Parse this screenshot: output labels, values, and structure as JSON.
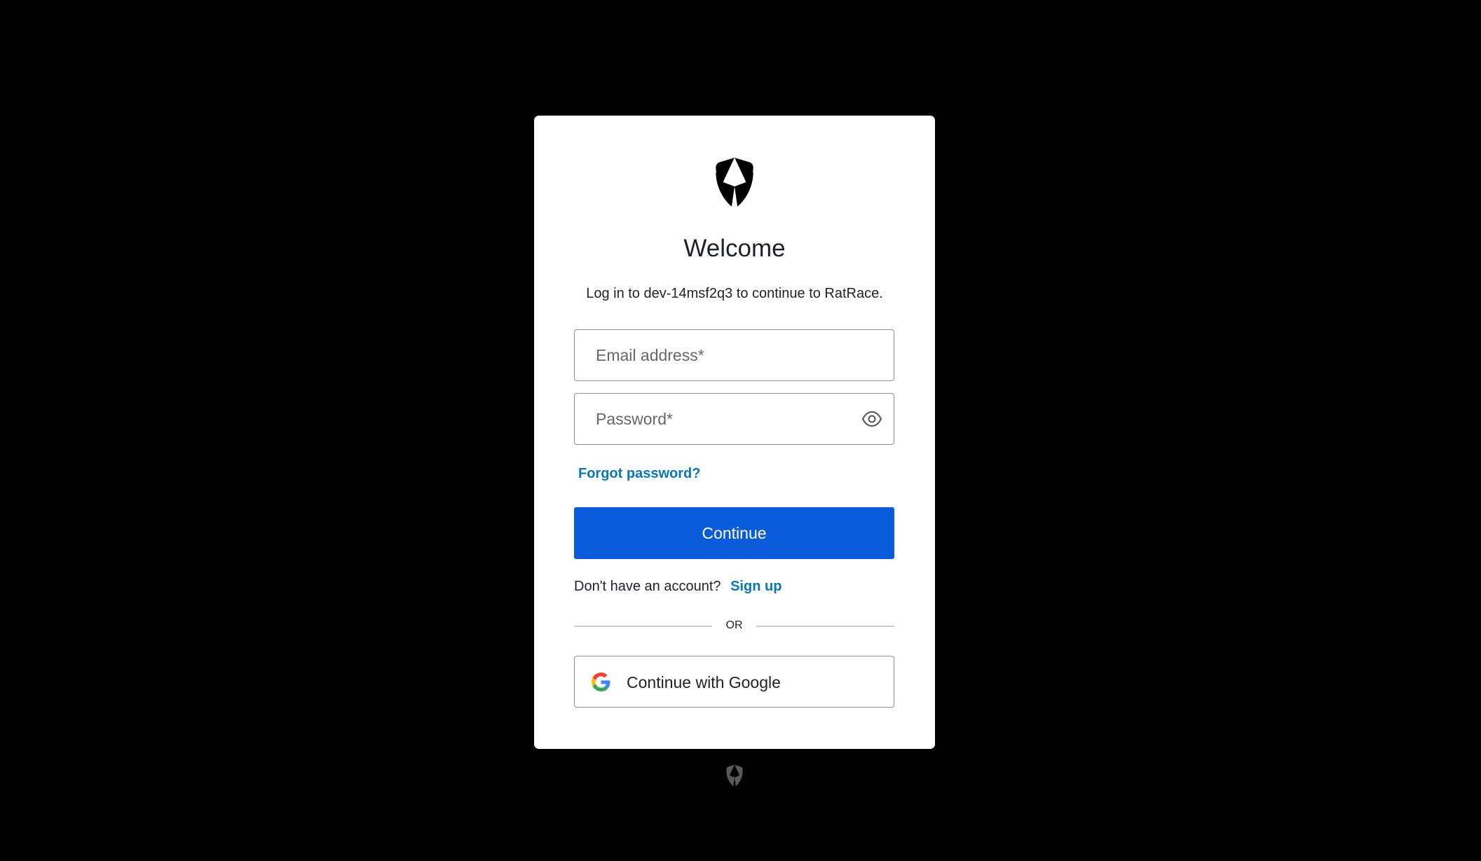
{
  "login": {
    "title": "Welcome",
    "subtitle": "Log in to dev-14msf2q3 to continue to RatRace.",
    "email_placeholder": "Email address*",
    "email_value": "",
    "password_placeholder": "Password*",
    "password_value": "",
    "forgot_password": "Forgot password?",
    "continue_label": "Continue",
    "signup_prompt": "Don't have an account?",
    "signup_link": "Sign up",
    "divider": "OR",
    "google_label": "Continue with Google"
  },
  "icons": {
    "logo": "auth0-shield-icon",
    "show_password": "eye-icon",
    "google": "google-g-icon",
    "footer": "auth0-shield-icon"
  },
  "colors": {
    "background": "#000000",
    "card": "#ffffff",
    "primary": "#0a5bd9",
    "link": "#0a76b5",
    "text": "#1e212a",
    "border": "#8c8f96"
  }
}
